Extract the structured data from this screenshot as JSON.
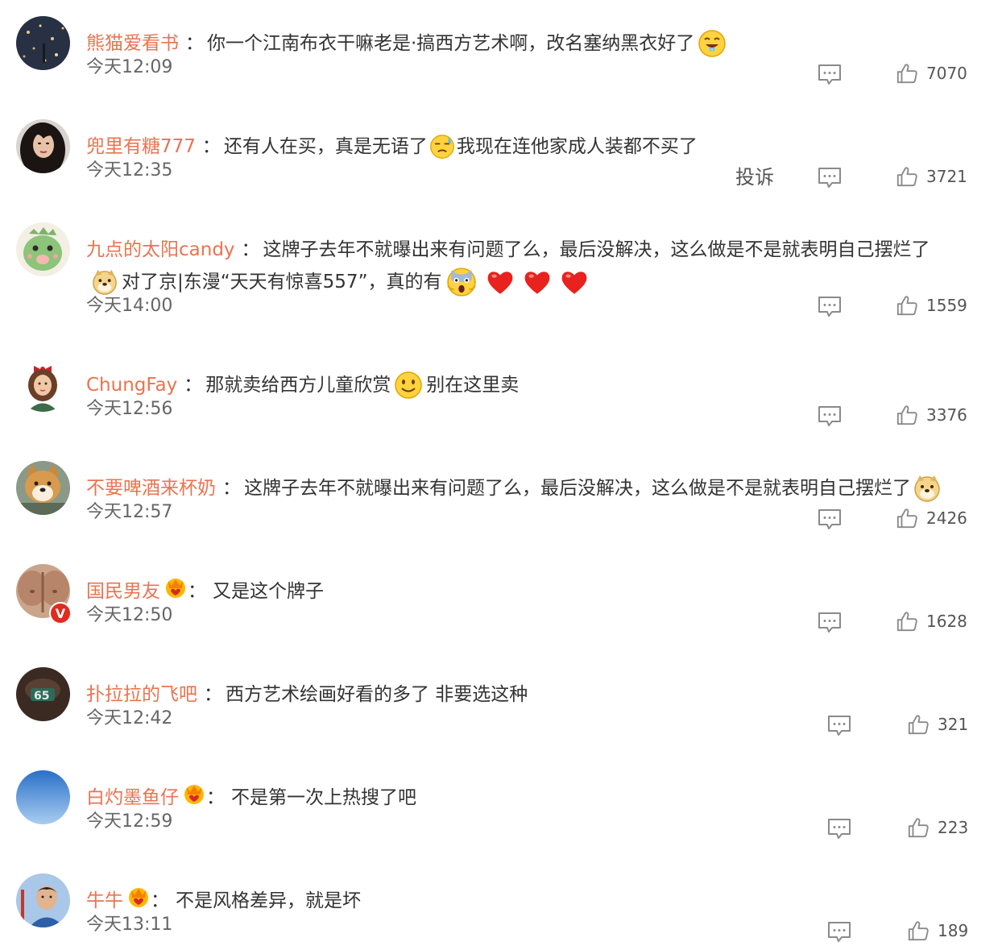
{
  "comments": [
    {
      "username": "熊猫爱看书",
      "avatar_icon": "night-city-avatar",
      "text": "你一个江南布衣干嘛老是·搞西方艺术啊，改名塞纳黑衣好了",
      "emoji": "drooling-face-emoji",
      "time": "今天12:09",
      "likes": "7070"
    },
    {
      "username": "兜里有糖777",
      "avatar_icon": "woman-portrait-avatar",
      "text_a": "还有人在买，真是无语了",
      "emoji": "sweat-face-emoji",
      "text_b": "我现在连他家成人装都不买了",
      "time": "今天12:35",
      "report_label": "投诉",
      "likes": "3721"
    },
    {
      "username": "九点的太阳candy",
      "avatar_icon": "green-dinosaur-avatar",
      "text": "这牌子去年不就曝出来有问题了么，最后没解决，这么做是不是就表明自己摆烂了",
      "line2_text_a": "对了京|东漫“天天有惊喜557”，真的有",
      "line2_emojis": [
        "doge-emoji",
        "shocked-face-emoji",
        "heart-emoji",
        "heart-emoji",
        "heart-emoji"
      ],
      "time": "今天14:00",
      "likes": "1559"
    },
    {
      "username": "ChungFay",
      "avatar_icon": "girl-with-bow-avatar",
      "text_a": "那就卖给西方儿童欣赏",
      "emoji": "smile-face-emoji",
      "text_b": "别在这里卖",
      "time": "今天12:56",
      "likes": "3376"
    },
    {
      "username": "不要啤酒来杯奶",
      "avatar_icon": "shiba-dog-avatar",
      "text": "这牌子去年不就曝出来有问题了么，最后没解决，这么做是不是就表明自己摆烂了",
      "emoji": "doge-emoji",
      "time": "今天12:57",
      "likes": "2426"
    },
    {
      "username": "国民男友",
      "avatar_icon": "torso-avatar",
      "verified_badge": "V",
      "badge_icon": "crown-badge-icon",
      "text": "又是这个牌子",
      "time": "今天12:50",
      "likes": "1628"
    },
    {
      "username": "扑拉拉的飞吧",
      "avatar_icon": "dark-photo-avatar",
      "text": "西方艺术绘画好看的多了 非要选这种",
      "time": "今天12:42",
      "likes": "321"
    },
    {
      "username": "白灼墨鱼仔",
      "avatar_icon": "blue-sky-avatar",
      "badge_icon": "crown-badge-icon",
      "text": "不是第一次上热搜了吧",
      "time": "今天12:59",
      "likes": "223"
    },
    {
      "username": "牛牛",
      "avatar_icon": "man-portrait-avatar",
      "badge_icon": "crown-badge-icon",
      "text": "不是风格差异，就是坏",
      "time": "今天13:11",
      "likes": "189"
    }
  ],
  "colors": {
    "username": "#eb7350",
    "text": "#333333",
    "meta": "#666666",
    "icon": "#8a8a8a"
  }
}
